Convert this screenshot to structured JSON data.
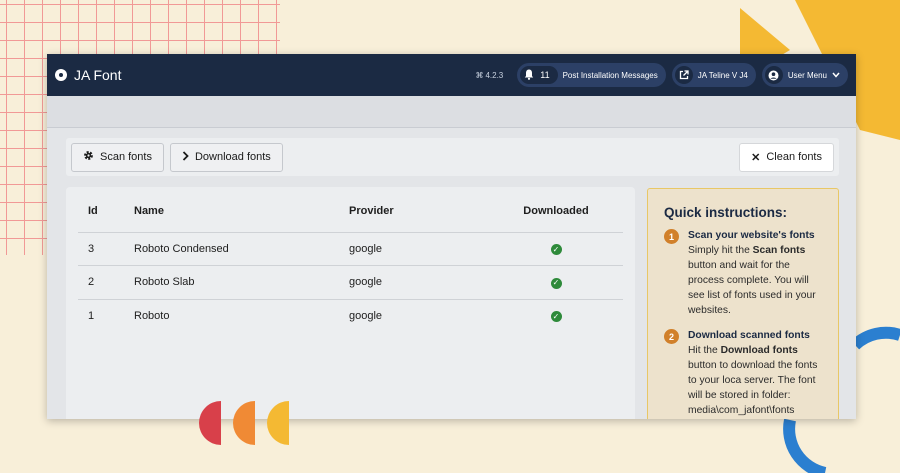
{
  "app": {
    "title": "JA Font"
  },
  "header": {
    "version": "4.2.3",
    "notifications_count": "11",
    "post_install_label": "Post Installation Messages",
    "site_label": "JA Teline V J4",
    "user_menu_label": "User Menu"
  },
  "toolbar": {
    "scan_label": "Scan fonts",
    "download_label": "Download fonts",
    "clean_label": "Clean fonts"
  },
  "table": {
    "headers": {
      "id": "Id",
      "name": "Name",
      "provider": "Provider",
      "downloaded": "Downloaded"
    },
    "rows": [
      {
        "id": "3",
        "name": "Roboto Condensed",
        "provider": "google",
        "downloaded": true
      },
      {
        "id": "2",
        "name": "Roboto Slab",
        "provider": "google",
        "downloaded": true
      },
      {
        "id": "1",
        "name": "Roboto",
        "provider": "google",
        "downloaded": true
      }
    ]
  },
  "instructions": {
    "title": "Quick instructions:",
    "steps": [
      {
        "num": "1",
        "title": "Scan your website's fonts",
        "text_a": "Simply hit the ",
        "text_bold": "Scan fonts",
        "text_b": " button and wait for the process complete. You will see list of fonts used in your websites."
      },
      {
        "num": "2",
        "title": "Download scanned fonts",
        "text_a": "Hit the ",
        "text_bold": "Download fonts",
        "text_b": " button to download the fonts to your loca server. The font will be stored in folder: media\\com_jafont\\fonts"
      }
    ]
  },
  "colors": {
    "header_bg": "#1b2a43",
    "check_green": "#2e8a3a",
    "step_orange": "#d1802a",
    "instr_border": "#e8c766",
    "page_bg": "#f8efd9"
  },
  "icons": [
    "joomla-icon",
    "bell-icon",
    "external-link-icon",
    "user-icon",
    "chevron-down-icon",
    "gear-icon",
    "chevron-right-icon",
    "close-icon",
    "check-circle-icon"
  ]
}
